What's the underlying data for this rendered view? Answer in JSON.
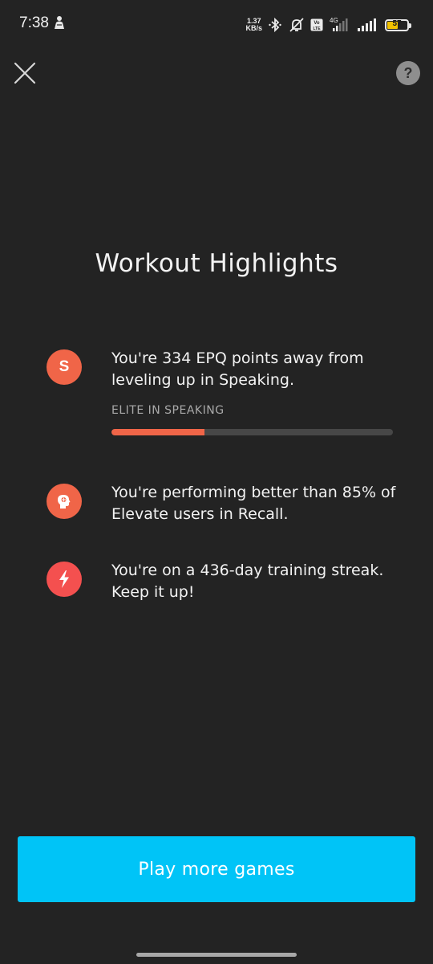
{
  "status_bar": {
    "time": "7:38",
    "net_speed_value": "1.37",
    "net_speed_unit": "KB/s",
    "volte_label": "Vo\nLTE",
    "network_type": "4G",
    "battery_level": "57",
    "battery_fill_percent": 57
  },
  "header": {
    "help_label": "?"
  },
  "page": {
    "title": "Workout Highlights"
  },
  "highlights": [
    {
      "icon": "speaking-s-icon",
      "icon_letter": "S",
      "text": "You're 334 EPQ points away from leveling up in Speaking.",
      "progress_label": "ELITE IN SPEAKING",
      "progress_percent": 33
    },
    {
      "icon": "brain-icon",
      "text": "You're performing better than 85% of Elevate users in Recall."
    },
    {
      "icon": "lightning-bolt-icon",
      "text": "You're on a 436-day training streak. Keep it up!"
    }
  ],
  "footer": {
    "play_button_label": "Play more games"
  },
  "colors": {
    "background": "#232323",
    "accent_orange": "#f06548",
    "streak_red": "#f4504f",
    "button_blue": "#00c4f7",
    "progress_track": "#474747"
  }
}
